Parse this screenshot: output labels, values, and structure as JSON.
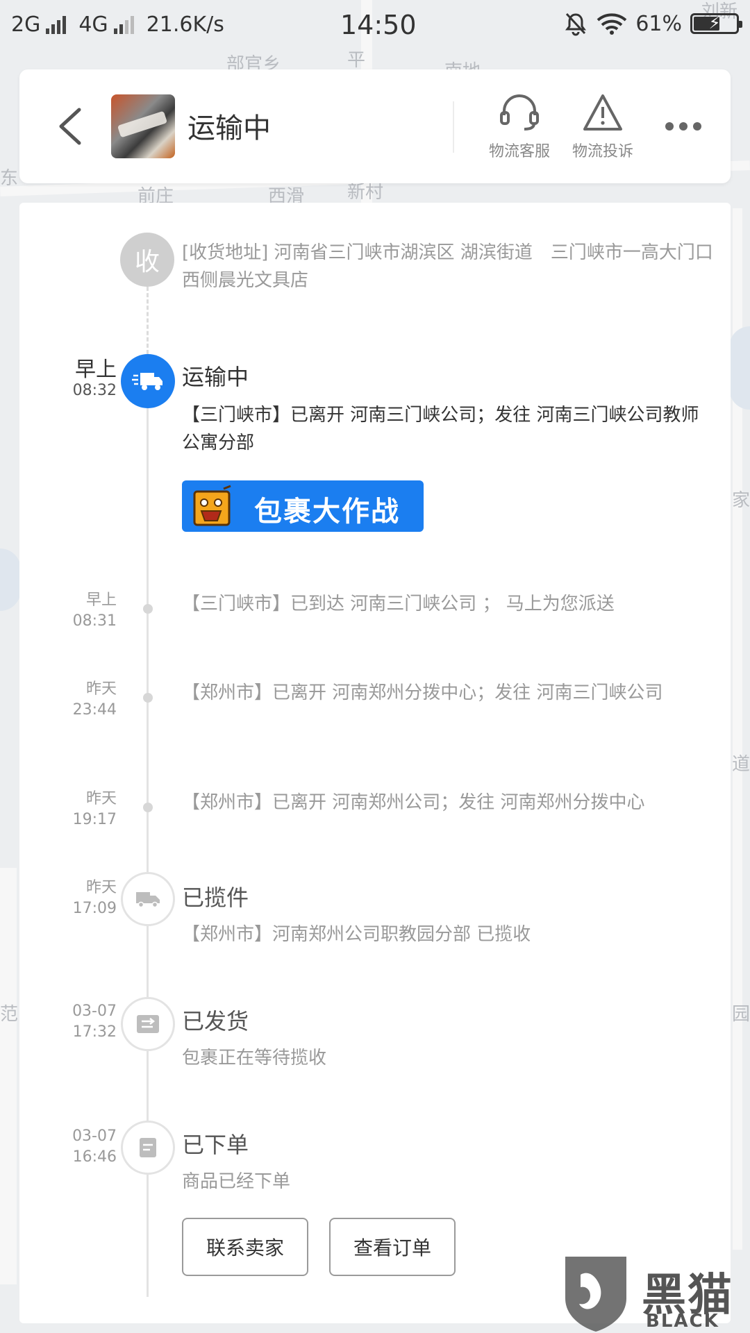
{
  "status_bar": {
    "network1": "2G",
    "network2": "4G",
    "speed": "21.6K/s",
    "time": "14:50",
    "battery": "61%",
    "battery_level": 0.61
  },
  "header": {
    "title": "运输中",
    "service_label": "物流客服",
    "complaint_label": "物流投诉"
  },
  "address": {
    "node_label": "收",
    "text": "[收货地址] 河南省三门峡市湖滨区 湖滨街道　三门峡市一高大门口西侧晨光文具店"
  },
  "current": {
    "date": "早上",
    "time": "08:32",
    "title": "运输中",
    "text": "【三门峡市】已离开 河南三门峡公司；发往 河南三门峡公司教师公寓分部",
    "promo": "包裹大作战"
  },
  "events": [
    {
      "date": "早上",
      "time": "08:31",
      "text": "【三门峡市】已到达 河南三门峡公司 ； 马上为您派送"
    },
    {
      "date": "昨天",
      "time": "23:44",
      "text": "【郑州市】已离开 河南郑州分拨中心；发往 河南三门峡公司"
    },
    {
      "date": "昨天",
      "time": "19:17",
      "text": "【郑州市】已离开 河南郑州公司；发往 河南郑州分拨中心"
    }
  ],
  "milestones": [
    {
      "date": "昨天",
      "time": "17:09",
      "title": "已揽件",
      "text": "【郑州市】河南郑州公司职教园分部 已揽收",
      "icon": "truck-icon"
    },
    {
      "date": "03-07",
      "time": "17:32",
      "title": "已发货",
      "text": "包裹正在等待揽收",
      "icon": "shipped-icon"
    },
    {
      "date": "03-07",
      "time": "16:46",
      "title": "已下单",
      "text": "商品已经下单",
      "icon": "order-icon"
    }
  ],
  "actions": {
    "contact_seller": "联系卖家",
    "view_order": "查看订单"
  },
  "map_labels": [
    "部官乡",
    "平",
    "南地",
    "前庄",
    "西滑",
    "新村",
    "东",
    "家",
    "道",
    "园",
    "范",
    "刘新"
  ],
  "watermark": {
    "cn": "黑猫",
    "en": "BLACK CAT"
  },
  "colors": {
    "accent": "#1b7ef0",
    "muted": "#999999",
    "node_grey": "#cfcfcf"
  }
}
